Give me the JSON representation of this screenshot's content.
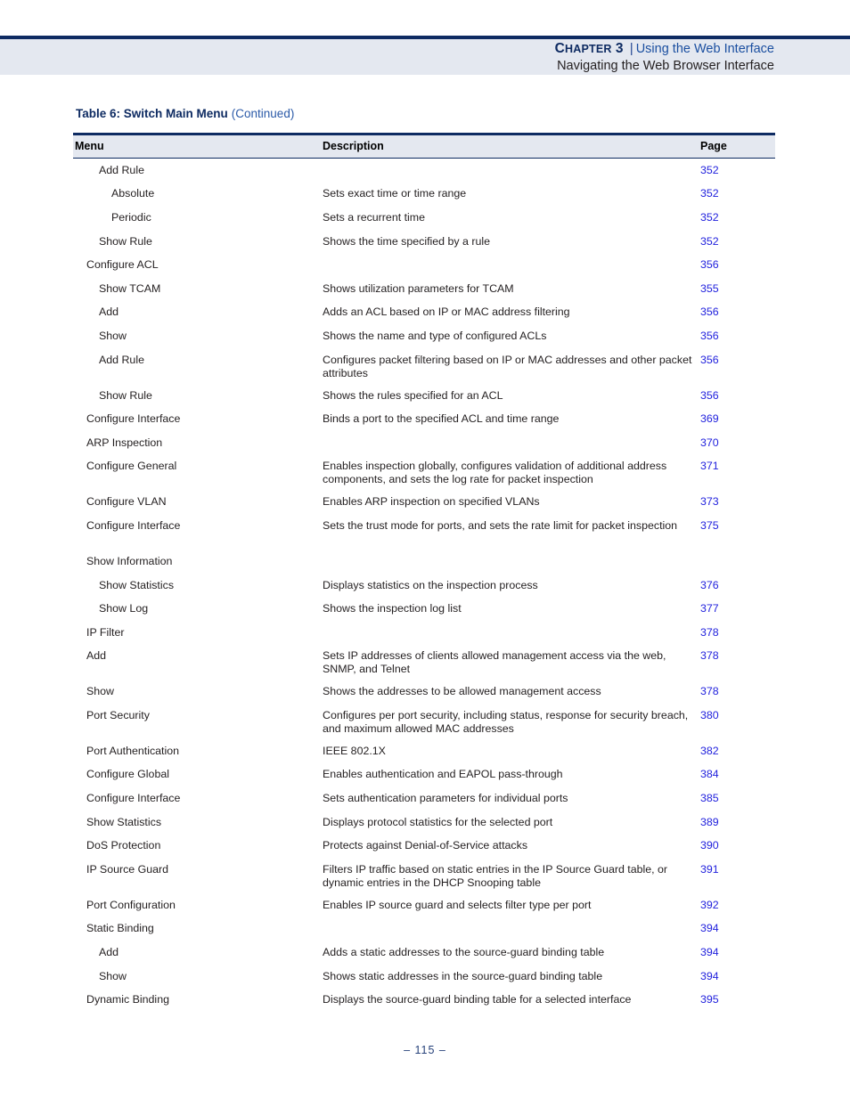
{
  "header": {
    "chapter_label": "Chapter 3",
    "separator": "|",
    "chapter_title": "Using the Web Interface",
    "section_title": "Navigating the Web Browser Interface"
  },
  "caption": {
    "main": "Table 6: Switch Main Menu",
    "continued": "(Continued)"
  },
  "table": {
    "columns": {
      "menu": "Menu",
      "description": "Description",
      "page": "Page"
    },
    "rows": [
      {
        "level": 1,
        "menu": "Add Rule",
        "description": "",
        "page": "352"
      },
      {
        "level": 2,
        "menu": "Absolute",
        "description": "Sets exact time or time range",
        "page": "352"
      },
      {
        "level": 2,
        "menu": "Periodic",
        "description": "Sets a recurrent time",
        "page": "352"
      },
      {
        "level": 1,
        "menu": "Show Rule",
        "description": "Shows the time specified by a rule",
        "page": "352"
      },
      {
        "level": 0,
        "menu": "Configure ACL",
        "description": "",
        "page": "356"
      },
      {
        "level": 1,
        "menu": "Show TCAM",
        "description": "Shows utilization parameters for TCAM",
        "page": "355"
      },
      {
        "level": 1,
        "menu": "Add",
        "description": "Adds an ACL based on IP or MAC address filtering",
        "page": "356"
      },
      {
        "level": 1,
        "menu": "Show",
        "description": "Shows the name and type of configured ACLs",
        "page": "356"
      },
      {
        "level": 1,
        "menu": "Add Rule",
        "description": "Configures packet filtering based on IP or MAC addresses and other packet attributes",
        "page": "356",
        "tall": true
      },
      {
        "level": 1,
        "menu": "Show Rule",
        "description": "Shows the rules specified for an ACL",
        "page": "356"
      },
      {
        "level": 0,
        "menu": "Configure Interface",
        "description": "Binds a port to the specified ACL and time range",
        "page": "369"
      },
      {
        "level": 0,
        "menu": "ARP Inspection",
        "description": "",
        "page": "370",
        "root": true
      },
      {
        "level": 0,
        "menu": "Configure General",
        "description": "Enables inspection globally, configures validation of additional address components, and sets the log rate for packet inspection",
        "page": "371",
        "tall": true
      },
      {
        "level": 0,
        "menu": "Configure VLAN",
        "description": "Enables ARP inspection on specified VLANs",
        "page": "373"
      },
      {
        "level": 0,
        "menu": "Configure Interface",
        "description": "Sets the trust mode for ports, and sets the rate limit for packet inspection",
        "page": "375",
        "tall": true
      },
      {
        "level": 0,
        "menu": "Show Information",
        "description": "",
        "page": ""
      },
      {
        "level": 1,
        "menu": "Show Statistics",
        "description": "Displays statistics on the inspection process",
        "page": "376"
      },
      {
        "level": 1,
        "menu": "Show Log",
        "description": "Shows the inspection log list",
        "page": "377"
      },
      {
        "level": 0,
        "menu": "IP Filter",
        "description": "",
        "page": "378"
      },
      {
        "level": 0,
        "menu": "Add",
        "description": "Sets IP addresses of clients allowed management access via the web, SNMP, and Telnet",
        "page": "378",
        "tall": true
      },
      {
        "level": 0,
        "menu": "Show",
        "description": "Shows the addresses to be allowed management access",
        "page": "378"
      },
      {
        "level": 0,
        "menu": "Port Security",
        "description": "Configures per port security, including status, response for security breach, and maximum allowed MAC addresses",
        "page": "380",
        "tall": true
      },
      {
        "level": 0,
        "menu": "Port Authentication",
        "description": "IEEE 802.1X",
        "page": "382"
      },
      {
        "level": 0,
        "menu": "Configure Global",
        "description": "Enables authentication and EAPOL pass-through",
        "page": "384"
      },
      {
        "level": 0,
        "menu": "Configure Interface",
        "description": "Sets authentication parameters for individual ports",
        "page": "385"
      },
      {
        "level": 0,
        "menu": "Show Statistics",
        "description": "Displays protocol statistics for the selected port",
        "page": "389"
      },
      {
        "level": 0,
        "menu": "DoS Protection",
        "description": "Protects against Denial-of-Service attacks",
        "page": "390"
      },
      {
        "level": 0,
        "menu": "IP Source Guard",
        "description": "Filters IP traffic based on static entries in the IP Source Guard table, or dynamic entries in the DHCP Snooping table",
        "page": "391",
        "tall": true
      },
      {
        "level": 0,
        "menu": "Port Configuration",
        "description": "Enables IP source guard and selects filter type per port",
        "page": "392"
      },
      {
        "level": 0,
        "menu": "Static Binding",
        "description": "",
        "page": "394"
      },
      {
        "level": 1,
        "menu": "Add",
        "description": "Adds a static addresses to the source-guard binding table",
        "page": "394"
      },
      {
        "level": 1,
        "menu": "Show",
        "description": "Shows static addresses in the source-guard binding table",
        "page": "394"
      },
      {
        "level": 0,
        "menu": "Dynamic Binding",
        "description": "Displays the source-guard binding table for a selected interface",
        "page": "395"
      }
    ]
  },
  "footer": {
    "page_number": "–  115  –"
  }
}
